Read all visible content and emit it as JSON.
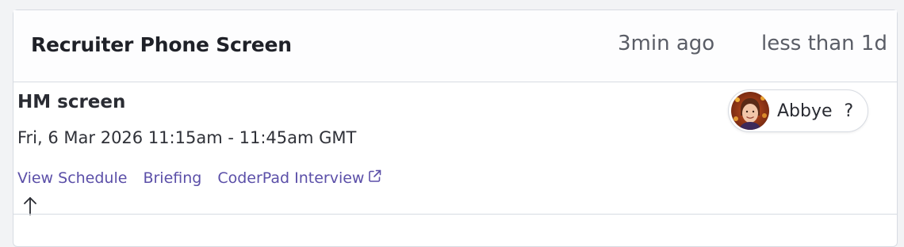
{
  "stage": {
    "title": "Recruiter Phone Screen",
    "updated": "3min ago",
    "duration": "less than 1d"
  },
  "interview": {
    "title": "HM screen",
    "time": "Fri, 6 Mar 2026 11:15am - 11:45am GMT",
    "links": {
      "view_schedule": "View Schedule",
      "briefing": "Briefing",
      "coderpad": "CoderPad Interview"
    },
    "interviewer": {
      "name": "Abbye",
      "status": "?"
    }
  },
  "colors": {
    "link": "#5b4fa8",
    "border": "#d7dbe2",
    "title": "#1f2128"
  },
  "icons": {
    "external_link": "external-link-icon",
    "cursor_arrow": "arrow-up-icon"
  }
}
